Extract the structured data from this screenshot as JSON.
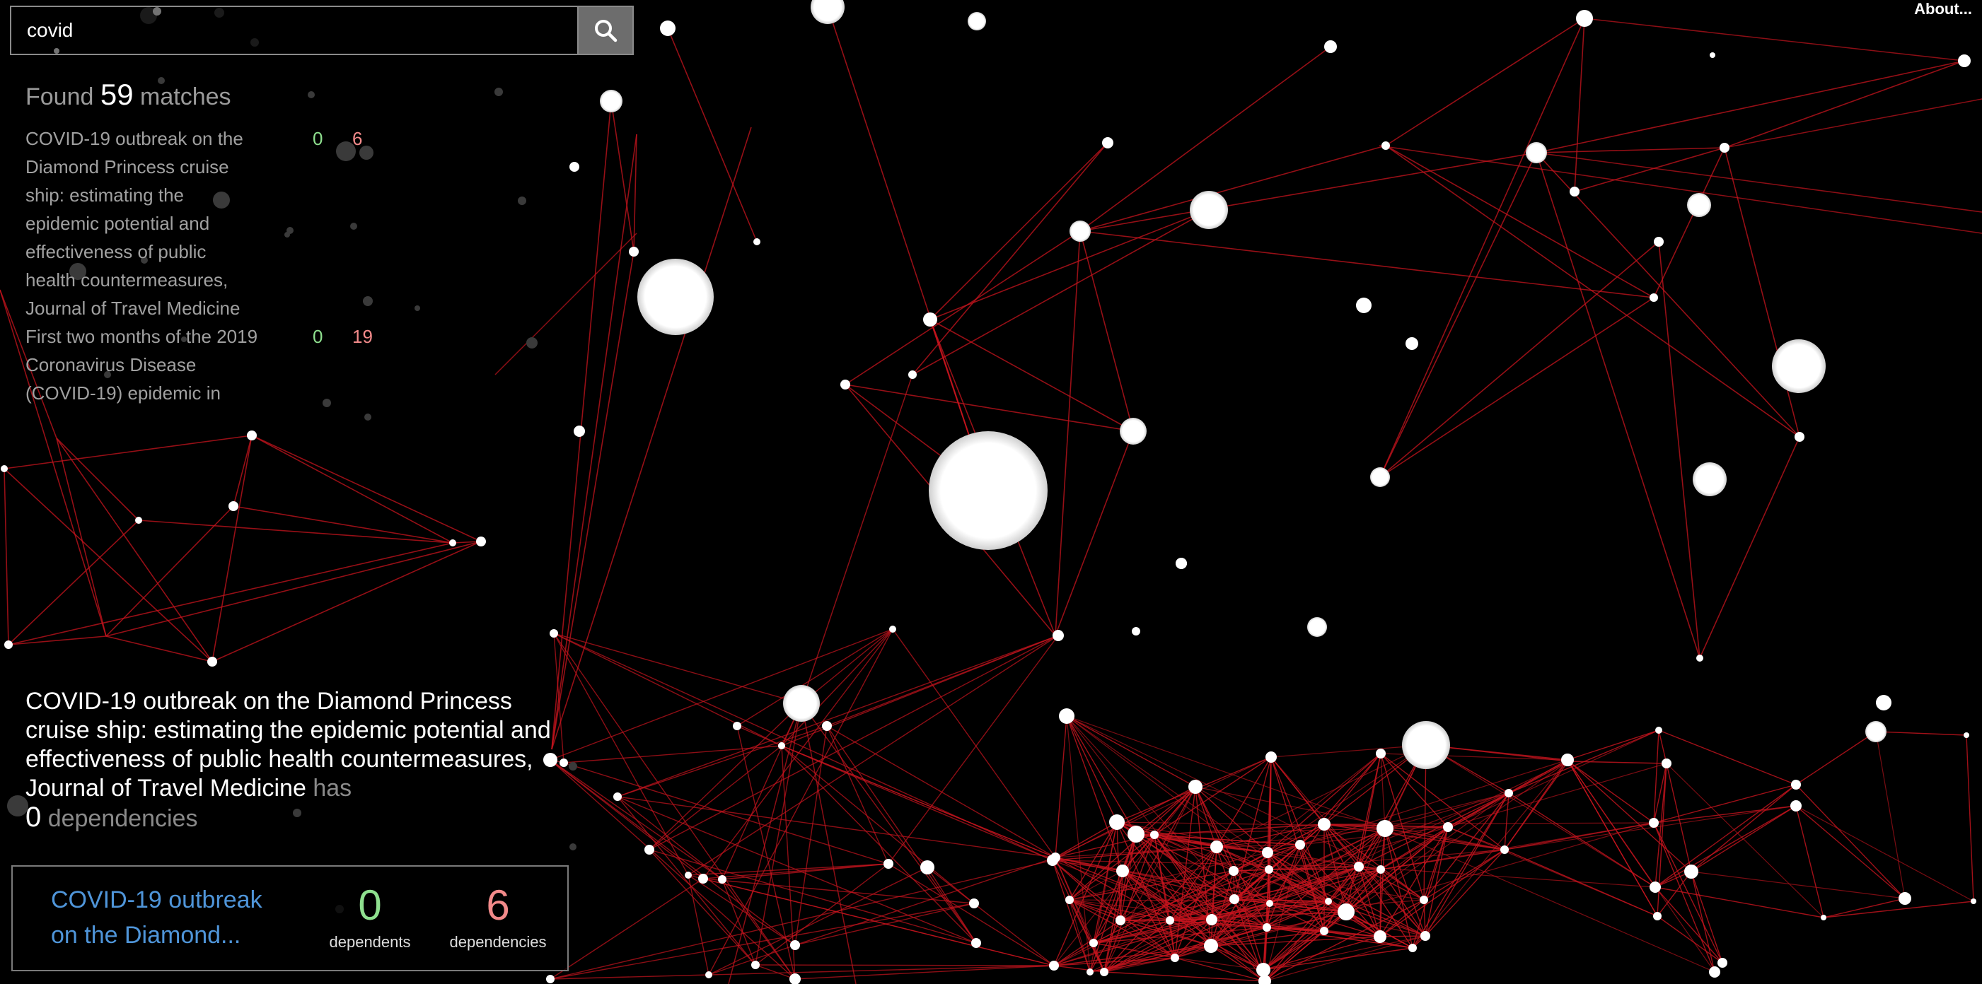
{
  "search": {
    "value": "covid",
    "button_icon": "search-icon"
  },
  "about": {
    "label": "About..."
  },
  "results": {
    "found_prefix": "Found",
    "found_count": "59",
    "found_suffix": "matches",
    "items": [
      {
        "title": "COVID-19 outbreak on the Diamond Princess cruise ship: estimating the epidemic potential and effectiveness of public health countermeasures, Journal of Travel Medicine",
        "dependents": "0",
        "dependencies": "6"
      },
      {
        "title": "First two months of the 2019 Coronavirus Disease (COVID-19) epidemic in",
        "dependents": "0",
        "dependencies": "19"
      }
    ]
  },
  "selected": {
    "title": "COVID-19 outbreak on the Diamond Princess cruise ship: estimating the epidemic potential and effectiveness of public health countermeasures, Journal of Travel Medicine",
    "has_label": "has",
    "count": "0",
    "count_label": "dependencies"
  },
  "card": {
    "title_line1": "COVID-19 outbreak",
    "title_line2": "on the Diamond...",
    "dependents_value": "0",
    "dependents_label": "dependents",
    "dependencies_value": "6",
    "dependencies_label": "dependencies"
  },
  "colors": {
    "background": "#000000",
    "edge": "#c8141e",
    "node": "#ffffff",
    "dependents": "#8fe08f",
    "dependencies": "#f28a8a",
    "link": "#4f95d9"
  }
}
